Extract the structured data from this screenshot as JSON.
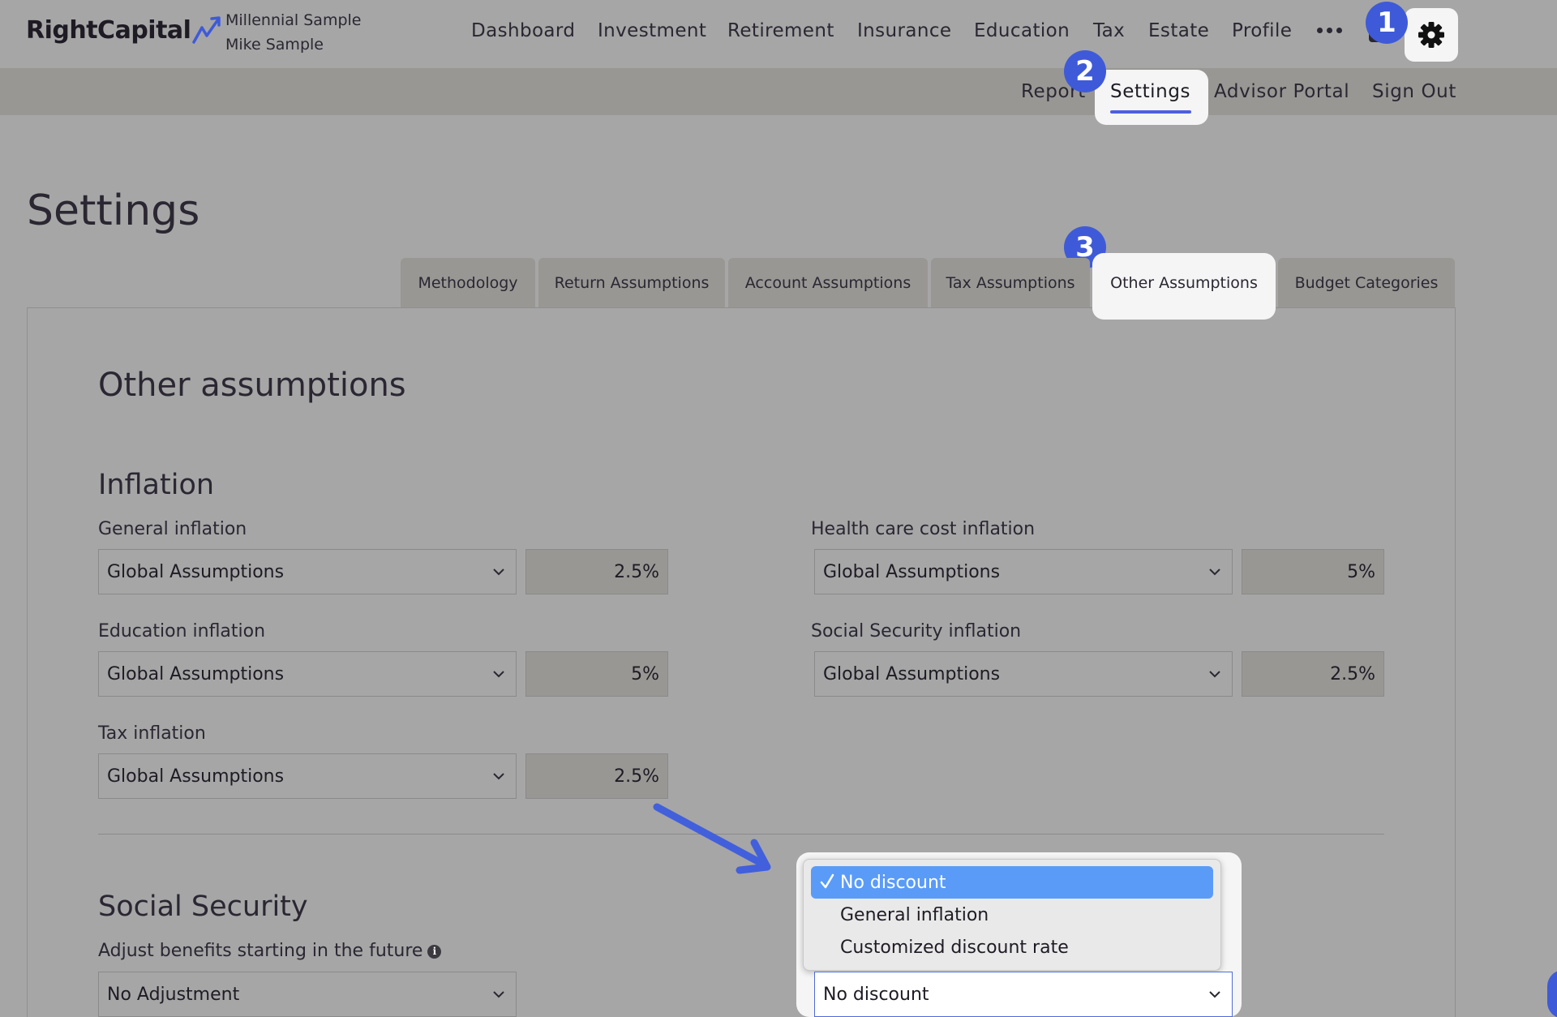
{
  "header": {
    "logo_text": "RightCapital",
    "client_household": "Millennial Sample",
    "client_name": "Mike Sample",
    "nav": [
      "Dashboard",
      "Investment",
      "Retirement",
      "Insurance",
      "Education",
      "Tax",
      "Estate",
      "Profile"
    ],
    "more_icon": "ellipsis-icon",
    "settings_icon": "gear-icon"
  },
  "subnav": {
    "report": "Report",
    "settings": "Settings",
    "advisor_portal": "Advisor Portal",
    "sign_out": "Sign Out"
  },
  "badges": {
    "one": "1",
    "two": "2",
    "three": "3"
  },
  "page": {
    "title": "Settings",
    "tabs": [
      "Methodology",
      "Return Assumptions",
      "Account Assumptions",
      "Tax Assumptions",
      "Other Assumptions",
      "Budget Categories"
    ],
    "active_tab": "Other Assumptions"
  },
  "panel": {
    "title": "Other assumptions",
    "inflation": {
      "heading": "Inflation",
      "general": {
        "label": "General inflation",
        "selected": "Global Assumptions",
        "value": "2.5%"
      },
      "health": {
        "label": "Health care cost inflation",
        "selected": "Global Assumptions",
        "value": "5%"
      },
      "education": {
        "label": "Education inflation",
        "selected": "Global Assumptions",
        "value": "5%"
      },
      "social_security": {
        "label": "Social Security inflation",
        "selected": "Global Assumptions",
        "value": "2.5%"
      },
      "tax": {
        "label": "Tax inflation",
        "selected": "Global Assumptions",
        "value": "2.5%"
      }
    },
    "social_security": {
      "heading": "Social Security",
      "adjust_label": "Adjust benefits starting in the future",
      "adjust_selected": "No Adjustment",
      "discount_selected": "No discount",
      "discount_options": [
        "No discount",
        "General inflation",
        "Customized discount rate"
      ]
    }
  },
  "colors": {
    "accent": "#3f5ad8",
    "highlight": "#f5f5f5",
    "selected_option": "#5a9bf8"
  }
}
